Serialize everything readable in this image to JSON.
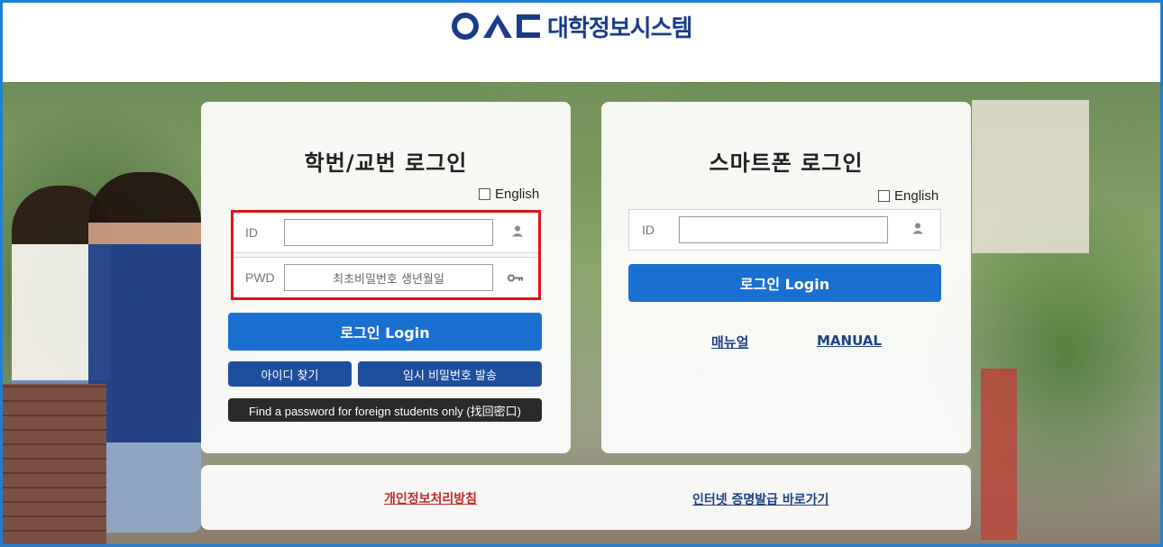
{
  "header": {
    "logo_text": "대학정보시스템"
  },
  "left_panel": {
    "title": "학번/교번 로그인",
    "english_label": "English",
    "id_label": "ID",
    "pwd_label": "PWD",
    "pwd_placeholder": "최초비밀번호 생년월일",
    "login_button": "로그인  Login",
    "find_id_button": "아이디 찾기",
    "temp_pwd_button": "임시 비밀번호 발송",
    "foreign_button": "Find a password for foreign students only (找回密口)"
  },
  "right_panel": {
    "title": "스마트폰 로그인",
    "english_label": "English",
    "id_label": "ID",
    "login_button": "로그인  Login",
    "manual_ko": "매뉴얼",
    "manual_en": "MANUAL"
  },
  "footer": {
    "privacy_link": "개인정보처리방침",
    "certificate_link": "인터넷 증명발급 바로가기"
  },
  "colors": {
    "accent": "#1a70d0",
    "navy": "#1f4e9c",
    "highlight": "#e0141a",
    "frame": "#1f7fd6"
  },
  "icons": {
    "user": "user-icon",
    "key": "key-icon"
  }
}
